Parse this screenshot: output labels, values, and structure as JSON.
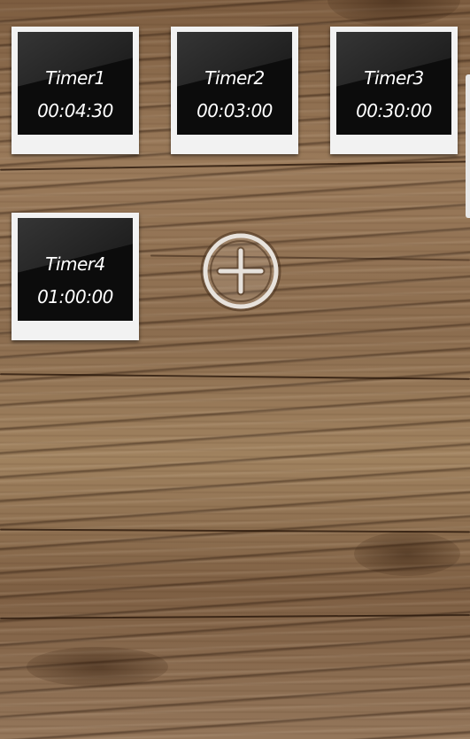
{
  "timers": [
    {
      "name": "Timer1",
      "time": "00:04:30"
    },
    {
      "name": "Timer2",
      "time": "00:03:00"
    },
    {
      "name": "Timer3",
      "time": "00:30:00"
    },
    {
      "name": "Timer4",
      "time": "01:00:00"
    }
  ],
  "add_button": {
    "icon": "plus-circle-icon"
  },
  "colors": {
    "card_frame": "#f2f2f2",
    "card_screen": "#0c0c0c",
    "card_text": "#ffffff",
    "background_wood": "#8a6a4b"
  }
}
